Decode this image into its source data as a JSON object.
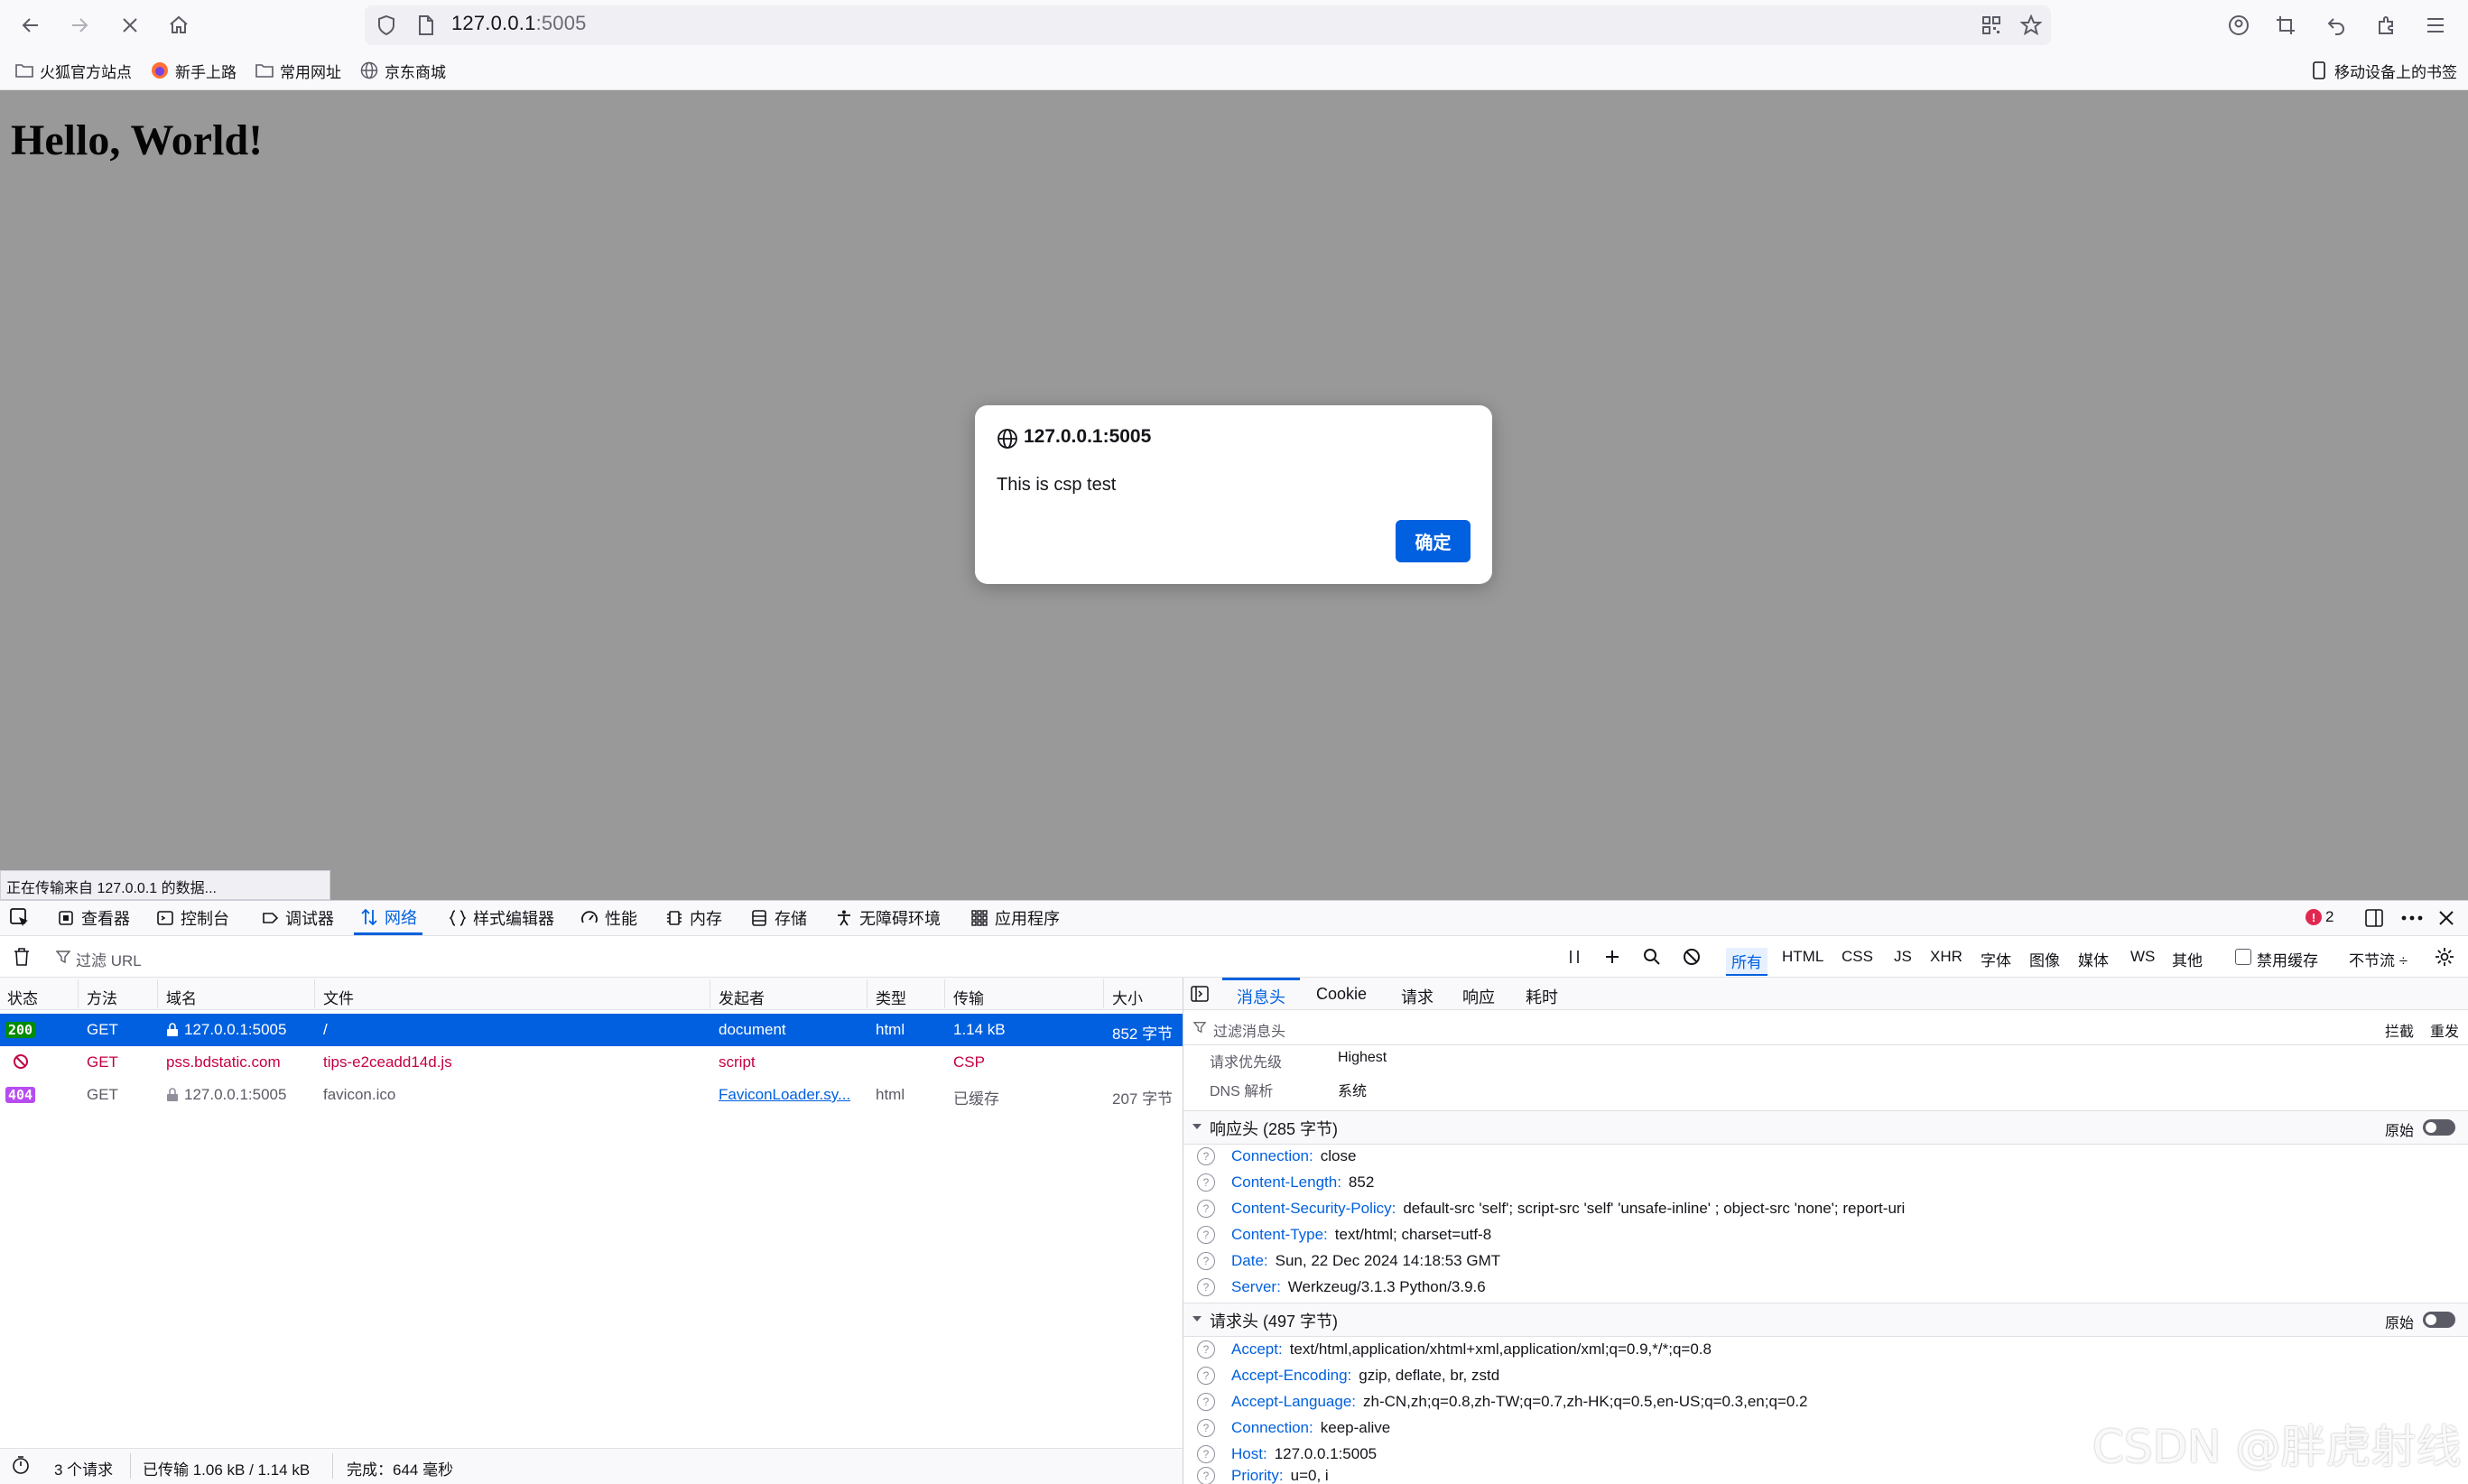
{
  "browser": {
    "url_host": "127.0.0.1",
    "url_port": ":5005",
    "bookmarks": [
      "火狐官方站点",
      "新手上路",
      "常用网址",
      "京东商城"
    ],
    "mobile_bookmarks": "移动设备上的书签"
  },
  "page": {
    "heading": "Hello, World!",
    "status_panel": "正在传输来自 127.0.0.1 的数据..."
  },
  "dialog": {
    "origin": "127.0.0.1:5005",
    "message": "This is csp test",
    "ok_label": "确定"
  },
  "devtools": {
    "tabs": [
      "查看器",
      "控制台",
      "调试器",
      "网络",
      "样式编辑器",
      "性能",
      "内存",
      "存储",
      "无障碍环境",
      "应用程序"
    ],
    "active_tab": "网络",
    "error_count": "2"
  },
  "network": {
    "filter_placeholder": "过滤 URL",
    "filter_types": [
      "所有",
      "HTML",
      "CSS",
      "JS",
      "XHR",
      "字体",
      "图像",
      "媒体",
      "WS",
      "其他"
    ],
    "disable_cache": "禁用缓存",
    "throttle": "不节流 ÷",
    "columns": [
      "状态",
      "方法",
      "域名",
      "文件",
      "发起者",
      "类型",
      "传输",
      "大小"
    ],
    "rows": [
      {
        "status": "200",
        "method": "GET",
        "domain": "127.0.0.1:5005",
        "file": "/",
        "initiator": "document",
        "type": "html",
        "transfer": "1.14 kB",
        "size": "852 字节"
      },
      {
        "status": "",
        "method": "GET",
        "domain": "pss.bdstatic.com",
        "file": "tips-e2ceadd14d.js",
        "initiator": "script",
        "type": "",
        "transfer": "CSP",
        "size": ""
      },
      {
        "status": "404",
        "method": "GET",
        "domain": "127.0.0.1:5005",
        "file": "favicon.ico",
        "initiator": "FaviconLoader.sy...",
        "type": "html",
        "transfer": "已缓存",
        "size": "207 字节"
      }
    ],
    "summary": {
      "requests": "3 个请求",
      "transferred": "已传输 1.06 kB / 1.14 kB",
      "finish": "完成：644 毫秒"
    }
  },
  "details": {
    "tabs": [
      "消息头",
      "Cookie",
      "请求",
      "响应",
      "耗时"
    ],
    "filter_placeholder": "过滤消息头",
    "block_label": "拦截",
    "resend_label": "重发",
    "priority_label": "请求优先级",
    "priority_value": "Highest",
    "dns_label": "DNS 解析",
    "dns_value": "系统",
    "raw_label": "原始",
    "response_title": "响应头 (285 字节)",
    "response_headers": [
      {
        "k": "Connection:",
        "v": "close"
      },
      {
        "k": "Content-Length:",
        "v": "852"
      },
      {
        "k": "Content-Security-Policy:",
        "v": "default-src 'self'; script-src 'self' 'unsafe-inline' ; object-src 'none'; report-uri"
      },
      {
        "k": "Content-Type:",
        "v": "text/html; charset=utf-8"
      },
      {
        "k": "Date:",
        "v": "Sun, 22 Dec 2024 14:18:53 GMT"
      },
      {
        "k": "Server:",
        "v": "Werkzeug/3.1.3 Python/3.9.6"
      }
    ],
    "request_title": "请求头 (497 字节)",
    "request_headers": [
      {
        "k": "Accept:",
        "v": "text/html,application/xhtml+xml,application/xml;q=0.9,*/*;q=0.8"
      },
      {
        "k": "Accept-Encoding:",
        "v": "gzip, deflate, br, zstd"
      },
      {
        "k": "Accept-Language:",
        "v": "zh-CN,zh;q=0.8,zh-TW;q=0.7,zh-HK;q=0.5,en-US;q=0.3,en;q=0.2"
      },
      {
        "k": "Connection:",
        "v": "keep-alive"
      },
      {
        "k": "Host:",
        "v": "127.0.0.1:5005"
      },
      {
        "k": "Priority:",
        "v": "u=0, i"
      }
    ]
  },
  "watermark": "CSDN @胖虎射线",
  "colors": {
    "accent": "#0060df",
    "ok_status": "#058b00",
    "not_found": "#b84cf0",
    "blocked": "#c50042"
  }
}
